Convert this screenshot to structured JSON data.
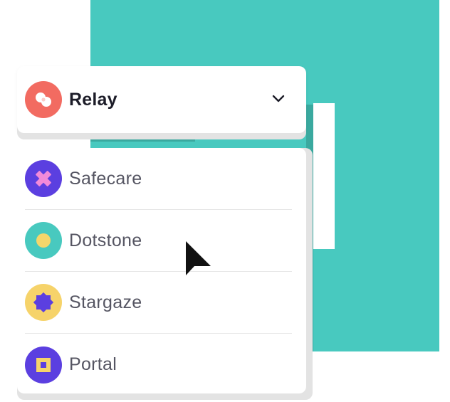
{
  "selected": {
    "label": "Relay",
    "icon": "relay-icon",
    "color": "#f26b61"
  },
  "options": [
    {
      "label": "Safecare",
      "icon": "cross-icon",
      "color": "#5b3fe0",
      "accent": "#f28ad9"
    },
    {
      "label": "Dotstone",
      "icon": "dot-icon",
      "color": "#48c9bf",
      "accent": "#f5d66b"
    },
    {
      "label": "Stargaze",
      "icon": "star-icon",
      "color": "#f6d36a",
      "accent": "#5b3fe0"
    },
    {
      "label": "Portal",
      "icon": "square-icon",
      "color": "#5b3fe0",
      "accent": "#f6d36a"
    }
  ],
  "colors": {
    "teal": "#48c9bf",
    "teal_dark": "#3aa99f",
    "text_dark": "#1c1c28",
    "text_muted": "#555562"
  }
}
